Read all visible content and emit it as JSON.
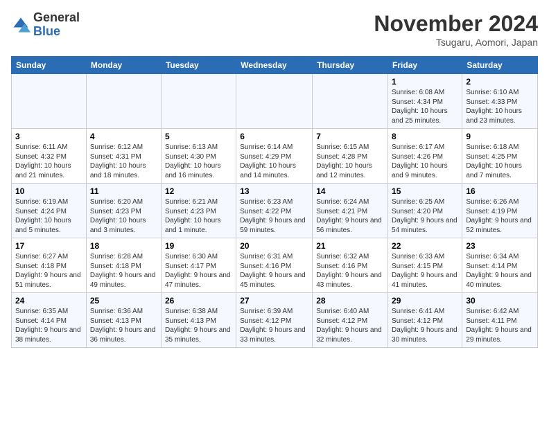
{
  "header": {
    "logo_general": "General",
    "logo_blue": "Blue",
    "month_title": "November 2024",
    "location": "Tsugaru, Aomori, Japan"
  },
  "weekdays": [
    "Sunday",
    "Monday",
    "Tuesday",
    "Wednesday",
    "Thursday",
    "Friday",
    "Saturday"
  ],
  "weeks": [
    [
      {
        "day": "",
        "info": ""
      },
      {
        "day": "",
        "info": ""
      },
      {
        "day": "",
        "info": ""
      },
      {
        "day": "",
        "info": ""
      },
      {
        "day": "",
        "info": ""
      },
      {
        "day": "1",
        "info": "Sunrise: 6:08 AM\nSunset: 4:34 PM\nDaylight: 10 hours and 25 minutes."
      },
      {
        "day": "2",
        "info": "Sunrise: 6:10 AM\nSunset: 4:33 PM\nDaylight: 10 hours and 23 minutes."
      }
    ],
    [
      {
        "day": "3",
        "info": "Sunrise: 6:11 AM\nSunset: 4:32 PM\nDaylight: 10 hours and 21 minutes."
      },
      {
        "day": "4",
        "info": "Sunrise: 6:12 AM\nSunset: 4:31 PM\nDaylight: 10 hours and 18 minutes."
      },
      {
        "day": "5",
        "info": "Sunrise: 6:13 AM\nSunset: 4:30 PM\nDaylight: 10 hours and 16 minutes."
      },
      {
        "day": "6",
        "info": "Sunrise: 6:14 AM\nSunset: 4:29 PM\nDaylight: 10 hours and 14 minutes."
      },
      {
        "day": "7",
        "info": "Sunrise: 6:15 AM\nSunset: 4:28 PM\nDaylight: 10 hours and 12 minutes."
      },
      {
        "day": "8",
        "info": "Sunrise: 6:17 AM\nSunset: 4:26 PM\nDaylight: 10 hours and 9 minutes."
      },
      {
        "day": "9",
        "info": "Sunrise: 6:18 AM\nSunset: 4:25 PM\nDaylight: 10 hours and 7 minutes."
      }
    ],
    [
      {
        "day": "10",
        "info": "Sunrise: 6:19 AM\nSunset: 4:24 PM\nDaylight: 10 hours and 5 minutes."
      },
      {
        "day": "11",
        "info": "Sunrise: 6:20 AM\nSunset: 4:23 PM\nDaylight: 10 hours and 3 minutes."
      },
      {
        "day": "12",
        "info": "Sunrise: 6:21 AM\nSunset: 4:23 PM\nDaylight: 10 hours and 1 minute."
      },
      {
        "day": "13",
        "info": "Sunrise: 6:23 AM\nSunset: 4:22 PM\nDaylight: 9 hours and 59 minutes."
      },
      {
        "day": "14",
        "info": "Sunrise: 6:24 AM\nSunset: 4:21 PM\nDaylight: 9 hours and 56 minutes."
      },
      {
        "day": "15",
        "info": "Sunrise: 6:25 AM\nSunset: 4:20 PM\nDaylight: 9 hours and 54 minutes."
      },
      {
        "day": "16",
        "info": "Sunrise: 6:26 AM\nSunset: 4:19 PM\nDaylight: 9 hours and 52 minutes."
      }
    ],
    [
      {
        "day": "17",
        "info": "Sunrise: 6:27 AM\nSunset: 4:18 PM\nDaylight: 9 hours and 51 minutes."
      },
      {
        "day": "18",
        "info": "Sunrise: 6:28 AM\nSunset: 4:18 PM\nDaylight: 9 hours and 49 minutes."
      },
      {
        "day": "19",
        "info": "Sunrise: 6:30 AM\nSunset: 4:17 PM\nDaylight: 9 hours and 47 minutes."
      },
      {
        "day": "20",
        "info": "Sunrise: 6:31 AM\nSunset: 4:16 PM\nDaylight: 9 hours and 45 minutes."
      },
      {
        "day": "21",
        "info": "Sunrise: 6:32 AM\nSunset: 4:16 PM\nDaylight: 9 hours and 43 minutes."
      },
      {
        "day": "22",
        "info": "Sunrise: 6:33 AM\nSunset: 4:15 PM\nDaylight: 9 hours and 41 minutes."
      },
      {
        "day": "23",
        "info": "Sunrise: 6:34 AM\nSunset: 4:14 PM\nDaylight: 9 hours and 40 minutes."
      }
    ],
    [
      {
        "day": "24",
        "info": "Sunrise: 6:35 AM\nSunset: 4:14 PM\nDaylight: 9 hours and 38 minutes."
      },
      {
        "day": "25",
        "info": "Sunrise: 6:36 AM\nSunset: 4:13 PM\nDaylight: 9 hours and 36 minutes."
      },
      {
        "day": "26",
        "info": "Sunrise: 6:38 AM\nSunset: 4:13 PM\nDaylight: 9 hours and 35 minutes."
      },
      {
        "day": "27",
        "info": "Sunrise: 6:39 AM\nSunset: 4:12 PM\nDaylight: 9 hours and 33 minutes."
      },
      {
        "day": "28",
        "info": "Sunrise: 6:40 AM\nSunset: 4:12 PM\nDaylight: 9 hours and 32 minutes."
      },
      {
        "day": "29",
        "info": "Sunrise: 6:41 AM\nSunset: 4:12 PM\nDaylight: 9 hours and 30 minutes."
      },
      {
        "day": "30",
        "info": "Sunrise: 6:42 AM\nSunset: 4:11 PM\nDaylight: 9 hours and 29 minutes."
      }
    ]
  ]
}
